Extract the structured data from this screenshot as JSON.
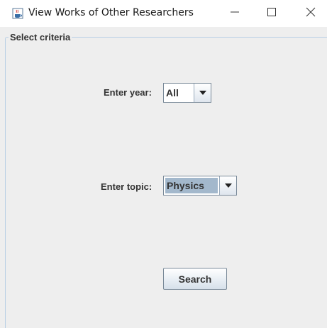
{
  "window": {
    "title": "View Works of Other Researchers",
    "icon": "java-cup-icon",
    "controls": [
      "minimize-icon",
      "maximize-icon",
      "close-icon"
    ]
  },
  "panel": {
    "group_title": "Select criteria"
  },
  "year": {
    "label": "Enter year:",
    "selected": "All"
  },
  "topic": {
    "label": "Enter topic:",
    "selected": "Physics"
  },
  "search": {
    "label": "Search"
  },
  "colors": {
    "background": "#eeeeee",
    "border": "#b8cfe5",
    "selection": "#a3b8cc",
    "text": "#333333"
  }
}
